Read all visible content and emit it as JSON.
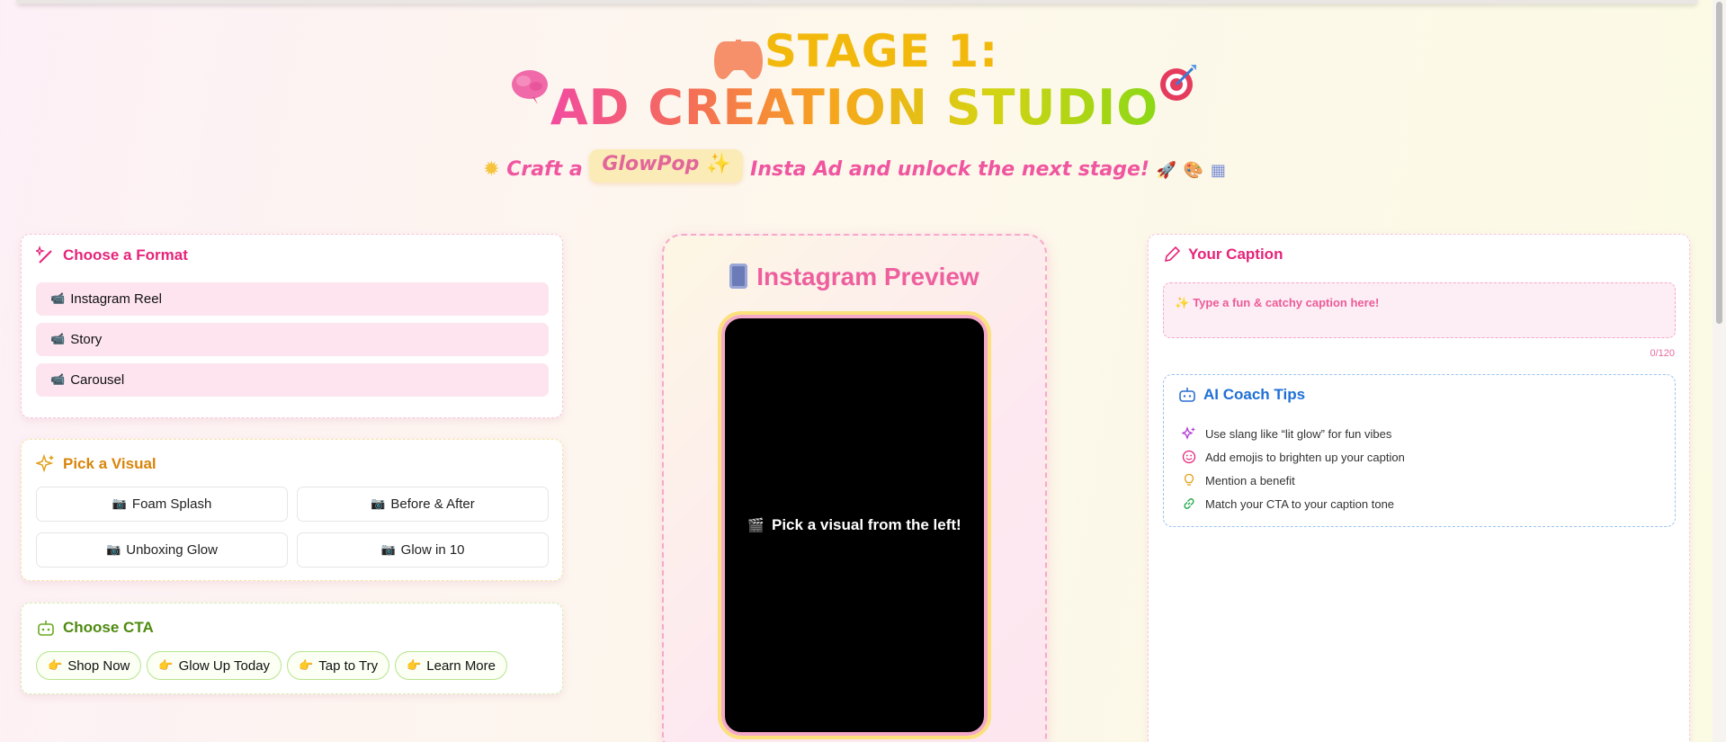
{
  "header": {
    "title_line1": "STAGE 1:",
    "title_line2": "AD CREATION STUDIO",
    "subtitle_pre": "Craft a",
    "brand": "GlowPop",
    "subtitle_post": "Insta Ad and unlock the next stage!",
    "icons": [
      "sun-icon",
      "controller-icon",
      "brain-icon",
      "target-icon",
      "rocket-icon",
      "palette-icon",
      "phone-icon"
    ]
  },
  "format": {
    "heading": "Choose a Format",
    "items": [
      "Instagram Reel",
      "Story",
      "Carousel"
    ]
  },
  "visual": {
    "heading": "Pick a Visual",
    "items": [
      "Foam Splash",
      "Before & After",
      "Unboxing Glow",
      "Glow in 10"
    ]
  },
  "cta": {
    "heading": "Choose CTA",
    "items": [
      "Shop Now",
      "Glow Up Today",
      "Tap to Try",
      "Learn More"
    ]
  },
  "preview": {
    "heading": "Instagram Preview",
    "placeholder": "Pick a visual from the left!"
  },
  "caption": {
    "heading": "Your Caption",
    "placeholder": "Type a fun & catchy caption here!",
    "counter": "0/120"
  },
  "coach": {
    "heading": "AI Coach Tips",
    "tips": [
      "Use slang like “lit glow” for fun vibes",
      "Add emojis to brighten up your caption",
      "Mention a benefit",
      "Match your CTA to your caption tone"
    ]
  },
  "colors": {
    "pink": "#e6247a",
    "orange": "#d9850a",
    "green": "#4f8a10",
    "blue": "#1f6fd6"
  }
}
